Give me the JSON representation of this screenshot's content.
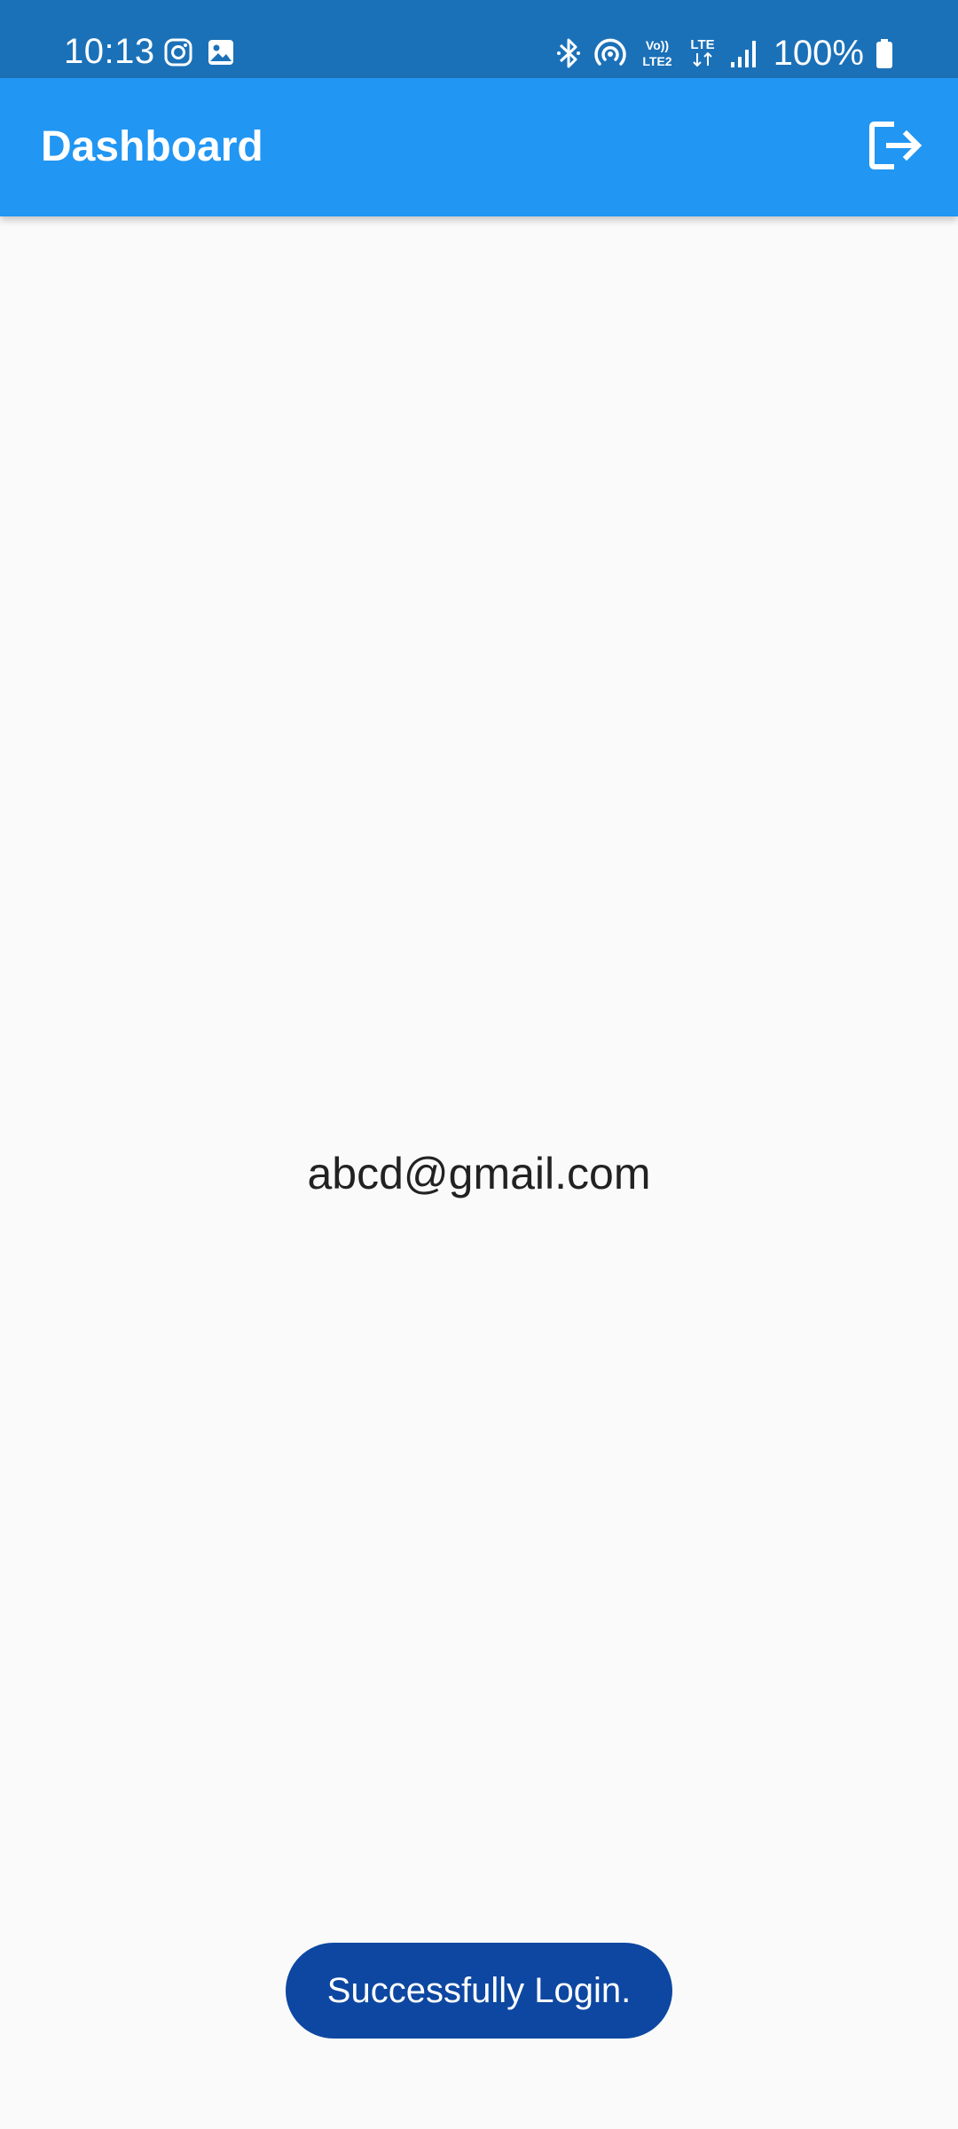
{
  "status_bar": {
    "time": "10:13",
    "battery_percent": "100%",
    "icons": [
      "instagram-icon",
      "gallery-icon",
      "bluetooth-icon",
      "hotspot-icon",
      "volte-icon",
      "lte-icon",
      "signal-icon",
      "battery-icon"
    ],
    "volte_label_top": "Vo))",
    "volte_label_bottom": "LTE2",
    "lte_label": "LTE",
    "bar_color": "#1b71b8"
  },
  "app_bar": {
    "title": "Dashboard",
    "action_icon": "logout-icon",
    "color": "#2196f3"
  },
  "main": {
    "email": "abcd@gmail.com"
  },
  "toast": {
    "message": "Successfully Login.",
    "color": "#0d47a1"
  }
}
